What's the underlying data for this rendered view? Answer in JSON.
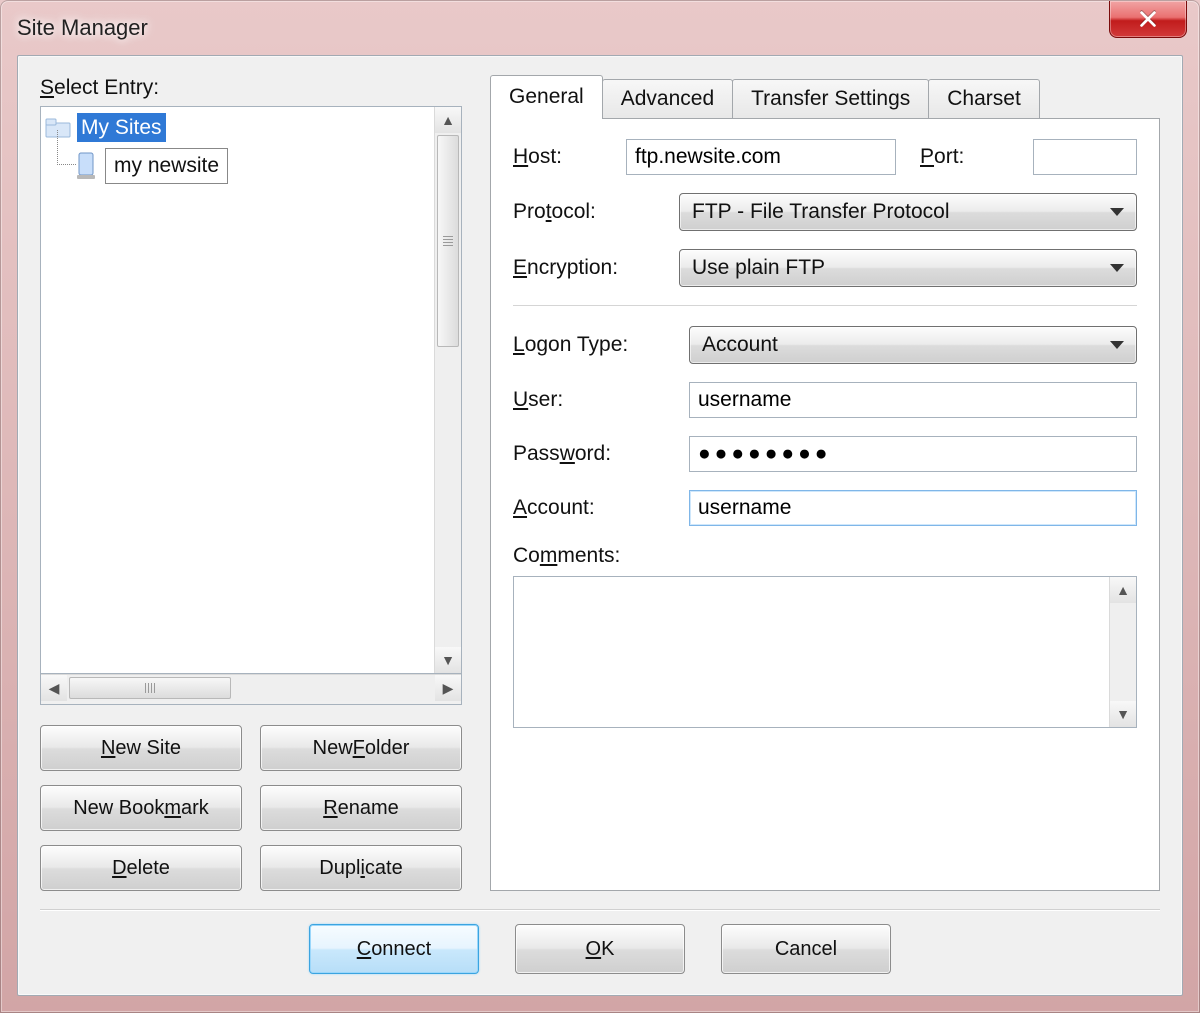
{
  "window": {
    "title": "Site Manager"
  },
  "left_panel": {
    "label_html": "<span class='mn'>S</span>elect Entry:",
    "tree": {
      "root": "My Sites",
      "items": [
        "my newsite"
      ]
    },
    "buttons": {
      "new_site_html": "<span class='mn'>N</span>ew Site",
      "new_folder_html": "New <span class='mn'>F</span>older",
      "new_bookmark_html": "New Book<span class='mn'>m</span>ark",
      "rename_html": "<span class='mn'>R</span>ename",
      "delete_html": "<span class='mn'>D</span>elete",
      "duplicate_html": "Dupl<span class='mn'>i</span>cate"
    }
  },
  "tabs": {
    "general": "General",
    "advanced": "Advanced",
    "transfer": "Transfer Settings",
    "charset": "Charset",
    "active": "general"
  },
  "general": {
    "host_label_html": "<span class='mn'>H</span>ost:",
    "host_value": "ftp.newsite.com",
    "port_label_html": "<span class='mn'>P</span>ort:",
    "port_value": "",
    "protocol_label_html": "Pro<span class='mn'>t</span>ocol:",
    "protocol_value": "FTP - File Transfer Protocol",
    "encryption_label_html": "<span class='mn'>E</span>ncryption:",
    "encryption_value": "Use plain FTP",
    "logon_label_html": "<span class='mn'>L</span>ogon Type:",
    "logon_value": "Account",
    "user_label_html": "<span class='mn'>U</span>ser:",
    "user_value": "username",
    "password_label_html": "Pass<span class='mn'>w</span>ord:",
    "password_value": "●●●●●●●●",
    "account_label_html": "<span class='mn'>A</span>ccount:",
    "account_value": "username",
    "comments_label_html": "Co<span class='mn'>m</span>ments:",
    "comments_value": ""
  },
  "footer": {
    "connect_html": "<span class='mn'>C</span>onnect",
    "ok_html": "<span class='mn'>O</span>K",
    "cancel": "Cancel"
  }
}
